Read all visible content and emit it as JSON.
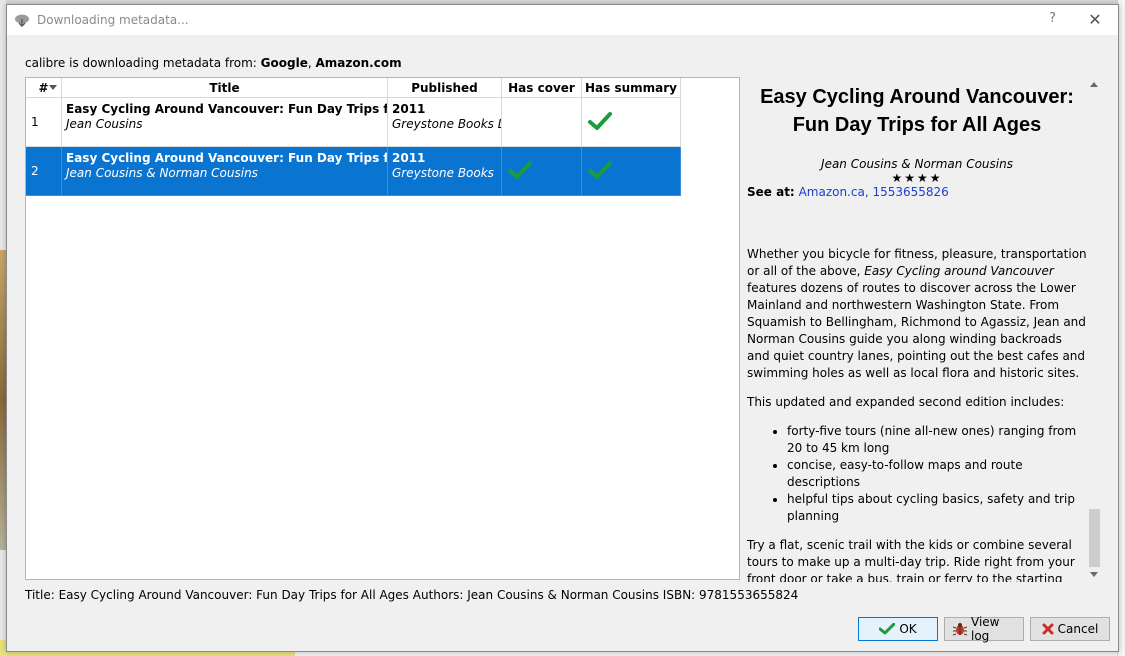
{
  "window": {
    "title": "Downloading metadata...",
    "help_label": "?",
    "close_label": "✕"
  },
  "source": {
    "prefix": "calibre is downloading metadata from: ",
    "sources": [
      "Google",
      "Amazon.com"
    ],
    "separator": ", "
  },
  "table": {
    "columns": [
      "#",
      "Title",
      "Published",
      "Has cover",
      "Has summary"
    ],
    "rows": [
      {
        "num": "1",
        "title": "Easy Cycling Around Vancouver: Fun Day Trips for All Ages",
        "authors": "Jean Cousins",
        "year": "2011",
        "publisher": "Greystone Books Ltd",
        "has_cover": false,
        "has_summary": true,
        "selected": false
      },
      {
        "num": "2",
        "title": "Easy Cycling Around Vancouver: Fun Day Trips for All Ages",
        "authors": "Jean Cousins & Norman Cousins",
        "year": "2011",
        "publisher": "Greystone Books",
        "has_cover": true,
        "has_summary": true,
        "selected": true
      }
    ]
  },
  "status": {
    "text": "Title: Easy Cycling Around Vancouver: Fun Day Trips for All Ages Authors: Jean Cousins & Norman Cousins ISBN: 9781553655824"
  },
  "details": {
    "title": "Easy Cycling Around Vancouver: Fun Day Trips for All Ages",
    "authors": "Jean Cousins & Norman Cousins",
    "rating": "★★★★",
    "see_at_label": "See at:",
    "see_at_links": [
      "Amazon.ca",
      "1553655826"
    ],
    "p1_before": "Whether you bicycle for fitness, pleasure, transportation or all of the above, ",
    "p1_em": "Easy Cycling around Vancouver",
    "p1_after": " features dozens of routes to discover across the Lower Mainland and northwestern Washington State. From Squamish to Bellingham, Richmond to Agassiz, Jean and Norman Cousins guide you along winding backroads and quiet country lanes, pointing out the best cafes and swimming holes as well as local flora and historic sites.",
    "p2": "This updated and expanded second edition includes:",
    "bullets": [
      "forty-five tours (nine all-new ones) ranging from 20 to 45 km long",
      "concise, easy-to-follow maps and route descriptions",
      "helpful tips about cycling basics, safety and trip planning"
    ],
    "p3": "Try a flat, scenic trail with the kids or combine several tours to make up a multi-day trip. Ride right from your front door or take a bus, train or ferry to the starting"
  },
  "buttons": {
    "ok": "OK",
    "view_log": "View log",
    "cancel": "Cancel"
  },
  "colors": {
    "selection": "#0a74d1",
    "check": "#1e9b3c",
    "link": "#1a3fd1",
    "cancel_icon": "#d32a2a"
  }
}
